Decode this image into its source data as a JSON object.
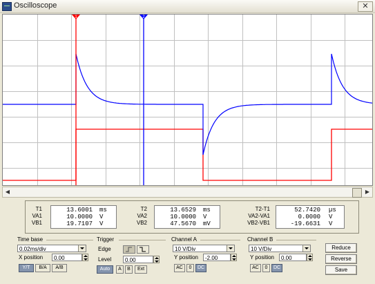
{
  "window": {
    "title": "Oscilloscope",
    "close_glyph": "✕"
  },
  "colors": {
    "channel_a": "#ff0000",
    "channel_b": "#0000ff",
    "grid": "#c0c0c0",
    "cursor_t1": "#ff0000",
    "cursor_t2": "#0000ff"
  },
  "cursors": {
    "t1_label": "1",
    "t2_label": "2"
  },
  "readout": {
    "col1": {
      "labels": [
        "T1",
        "VA1",
        "VB1"
      ],
      "values": [
        "13.6001",
        "10.0000",
        "19.7107"
      ],
      "units": [
        "ms",
        "V",
        "V"
      ]
    },
    "col2": {
      "labels": [
        "T2",
        "VA2",
        "VB2"
      ],
      "values": [
        "13.6529",
        "10.0000",
        "47.5670"
      ],
      "units": [
        "ms",
        "V",
        "mV"
      ]
    },
    "col3": {
      "labels": [
        "T2-T1",
        "VA2-VA1",
        "VB2-VB1"
      ],
      "values": [
        "52.7420",
        "0.0000",
        "-19.6631"
      ],
      "units": [
        "µs",
        "V",
        "V"
      ]
    }
  },
  "timebase": {
    "title": "Time base",
    "scale": "0.02ms/div",
    "xpos_label": "X position",
    "xpos_value": "0.00",
    "modes": [
      "Y/T",
      "B/A",
      "A/B"
    ],
    "active_mode": "Y/T"
  },
  "trigger": {
    "title": "Trigger",
    "edge_label": "Edge",
    "level_label": "Level",
    "level_value": "0.00",
    "sources": [
      "Auto",
      "A",
      "B",
      "Ext"
    ]
  },
  "channel_a": {
    "title": "Channel A",
    "scale": "10 V/Div",
    "ypos_label": "Y position",
    "ypos_value": "-2.00",
    "coupling": [
      "AC",
      "0",
      "DC"
    ]
  },
  "channel_b": {
    "title": "Channel B",
    "scale": "10 V/Div",
    "ypos_label": "Y position",
    "ypos_value": "0.00",
    "coupling": [
      "AC",
      "0",
      "DC"
    ]
  },
  "buttons": {
    "reduce": "Reduce",
    "reverse": "Reverse",
    "save": "Save"
  },
  "icons": {
    "scroll_left": "◀",
    "scroll_right": "▶",
    "edge_rising": "rising-edge-icon",
    "edge_falling": "falling-edge-icon"
  }
}
